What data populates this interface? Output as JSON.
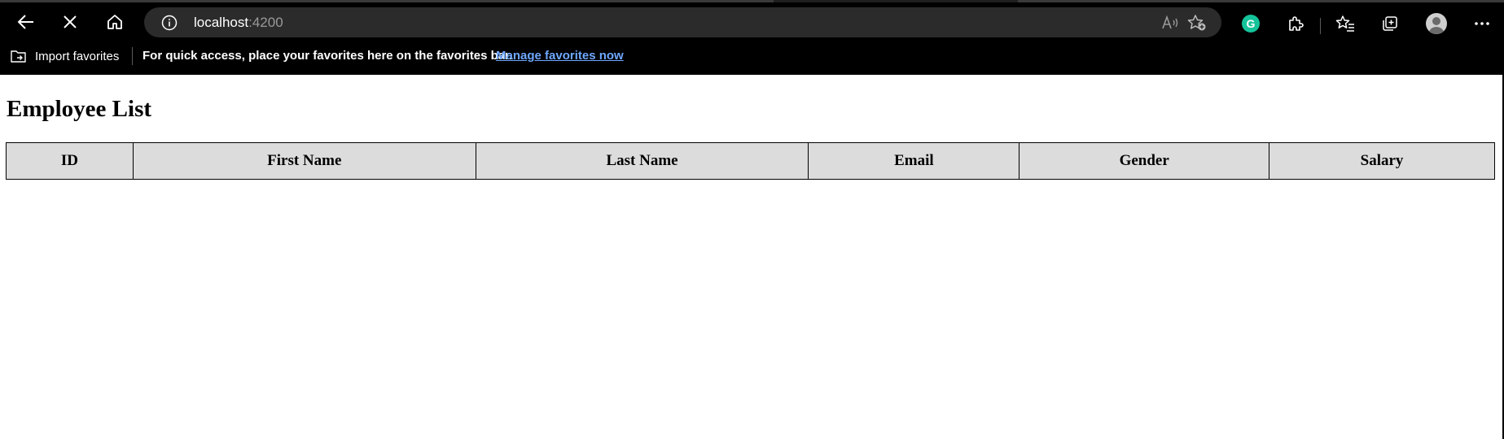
{
  "browser": {
    "address_url_host": "localhost",
    "address_url_port": ":4200",
    "favorites_bar": {
      "import_label": "Import favorites",
      "message": "For quick access, place your favorites here on the favorites bar.",
      "manage_link": "Manage favorites now"
    },
    "colors": {
      "chrome_bg": "#000000",
      "addressbar_bg": "#2b2b2b",
      "link": "#6fa8ff",
      "grammarly": "#15c39a"
    },
    "icons": {
      "back": "back-arrow-icon",
      "stop": "close-icon",
      "home": "home-icon",
      "site_info": "info-icon",
      "read_aloud": "read-aloud-icon",
      "add_favorite": "add-favorite-icon",
      "grammarly": "grammarly-icon",
      "extensions": "extensions-icon",
      "favorites": "favorites-icon",
      "collections": "collections-icon",
      "profile": "profile-avatar-icon",
      "more": "more-icon"
    },
    "grammarly_letter": "G"
  },
  "page": {
    "title": "Employee List",
    "table": {
      "columns": [
        "ID",
        "First Name",
        "Last Name",
        "Email",
        "Gender",
        "Salary"
      ],
      "header_bg": "#dcdcdc",
      "rows": []
    }
  }
}
